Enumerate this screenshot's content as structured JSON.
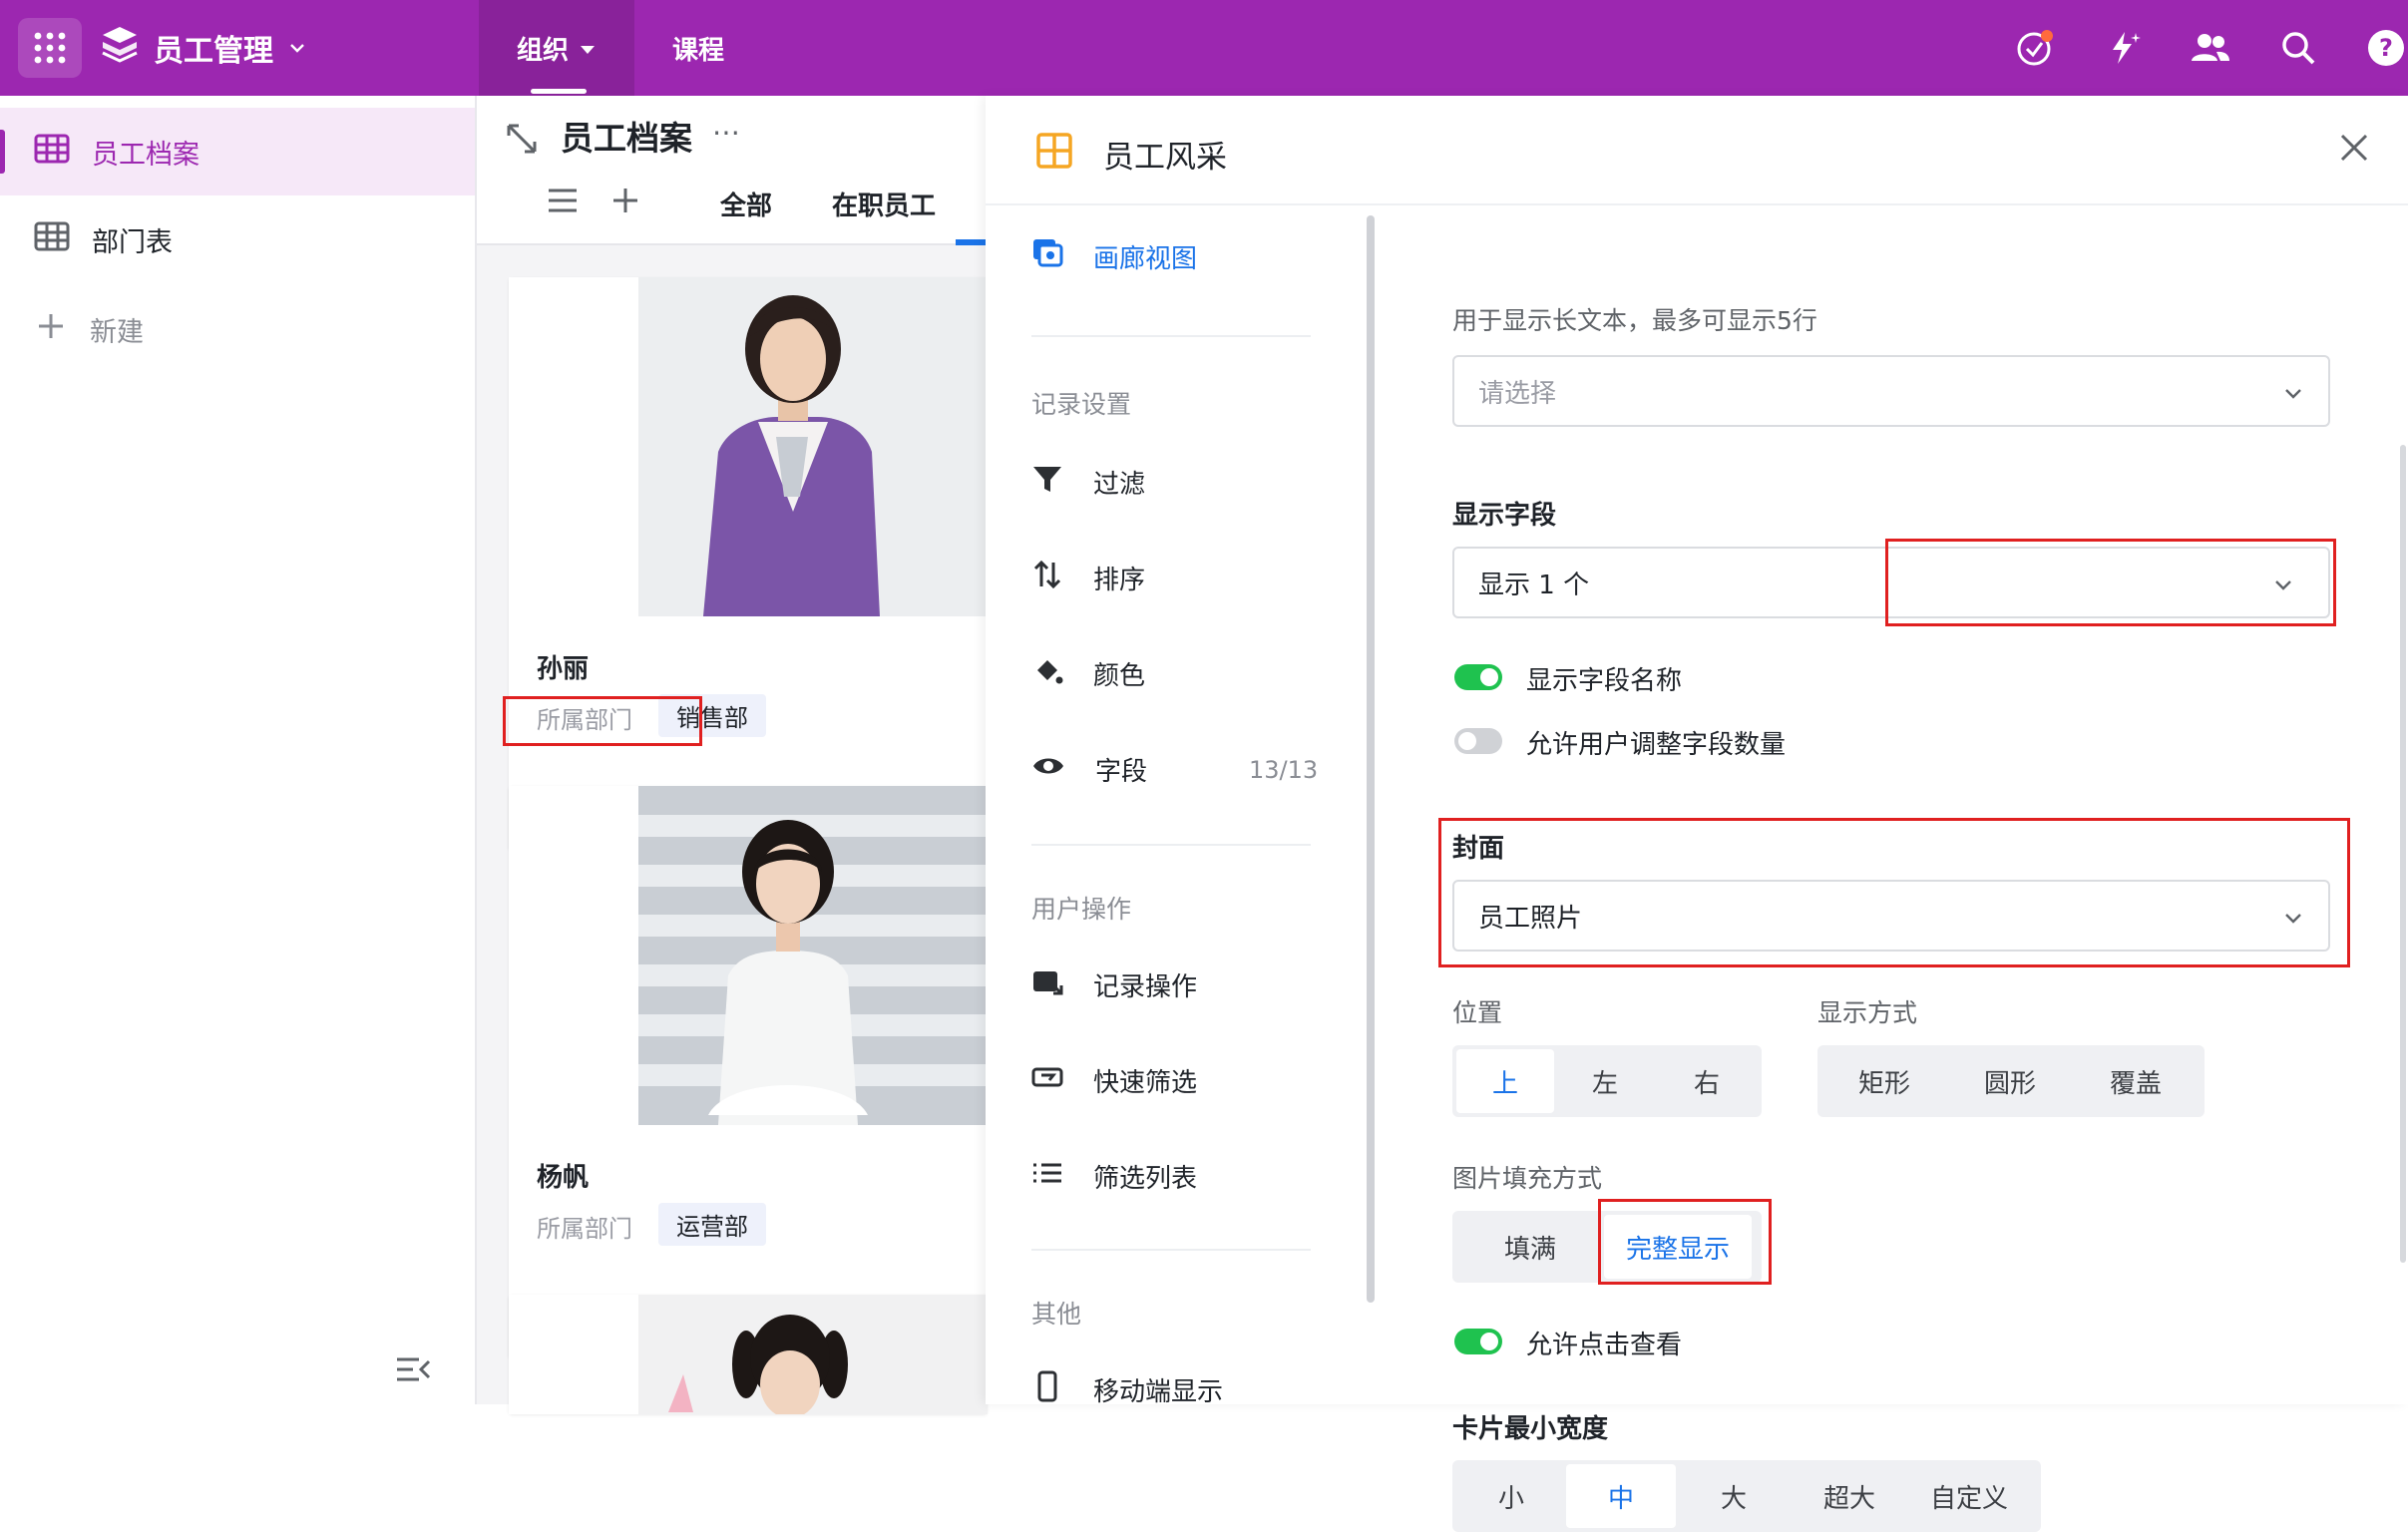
{
  "topbar": {
    "app_name": "员工管理",
    "nav": [
      "组织",
      "课程"
    ],
    "colors": {
      "brand": "#9c27b0"
    }
  },
  "sidebar": {
    "items": [
      {
        "label": "员工档案",
        "icon": "grid-table-icon",
        "active": true
      },
      {
        "label": "部门表",
        "icon": "grid-table-icon",
        "active": false
      },
      {
        "label": "新建",
        "icon": "plus-icon",
        "active": false
      }
    ]
  },
  "main": {
    "title": "员工档案",
    "view_tabs": [
      "全部",
      "在职员工"
    ],
    "cards": [
      {
        "name": "孙丽",
        "field_label": "所属部门",
        "tag": "销售部",
        "outfit": "purple"
      },
      {
        "name": "杨帆",
        "field_label": "所属部门",
        "tag": "运营部",
        "outfit": "white"
      },
      {
        "name": "",
        "field_label": "",
        "tag": "",
        "outfit": "stripe"
      }
    ]
  },
  "panel": {
    "title": "员工风采",
    "nav": {
      "gallery_view": "画廊视图",
      "record_settings": "记录设置",
      "filter": "过滤",
      "sort": "排序",
      "color": "颜色",
      "fields": "字段",
      "fields_count": "13/13",
      "user_ops": "用户操作",
      "record_ops": "记录操作",
      "quick_filter": "快速筛选",
      "filter_list": "筛选列表",
      "other": "其他",
      "mobile": "移动端显示"
    },
    "settings": {
      "longtext_hint": "用于显示长文本，最多可显示5行",
      "longtext_placeholder": "请选择",
      "display_fields_label": "显示字段",
      "display_fields_value": "显示 1 个",
      "toggle_show_field_name": "显示字段名称",
      "toggle_allow_adjust": "允许用户调整字段数量",
      "cover_label": "封面",
      "cover_value": "员工照片",
      "position_label": "位置",
      "position_options": [
        "上",
        "左",
        "右"
      ],
      "position_selected": "上",
      "display_mode_label": "显示方式",
      "display_mode_options": [
        "矩形",
        "圆形",
        "覆盖"
      ],
      "fill_label": "图片填充方式",
      "fill_options": [
        "填满",
        "完整显示"
      ],
      "fill_selected": "完整显示",
      "toggle_allow_click": "允许点击查看",
      "min_width_label": "卡片最小宽度",
      "min_width_options": [
        "小",
        "中",
        "大",
        "超大",
        "自定义"
      ],
      "min_width_selected": "中"
    }
  }
}
